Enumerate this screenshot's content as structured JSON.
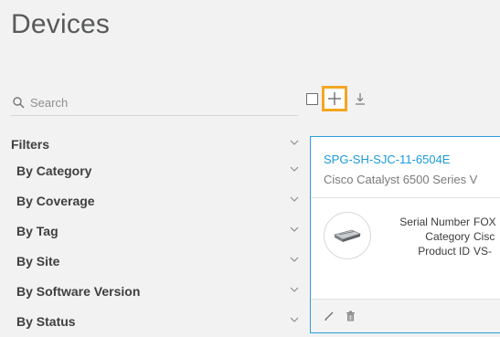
{
  "page": {
    "title": "Devices"
  },
  "search": {
    "placeholder": "Search"
  },
  "filters": {
    "header": "Filters",
    "items": [
      {
        "label": "By Category"
      },
      {
        "label": "By Coverage"
      },
      {
        "label": "By Tag"
      },
      {
        "label": "By Site"
      },
      {
        "label": "By Software Version"
      },
      {
        "label": "By Status"
      }
    ]
  },
  "device_card": {
    "name": "SPG-SH-SJC-11-6504E",
    "model": "Cisco Catalyst 6500 Series V",
    "specs": [
      {
        "key": "Serial Number",
        "value": "FOX"
      },
      {
        "key": "Category",
        "value": "Cisc"
      },
      {
        "key": "Product ID",
        "value": "VS-"
      }
    ]
  },
  "colors": {
    "accent": "#1a9bd7",
    "highlight": "#f5a623",
    "background": "#f2f2f2"
  },
  "icons": [
    "search-icon",
    "checkbox",
    "plus-icon",
    "download-icon",
    "chevron-down-icon",
    "edit-icon",
    "trash-icon"
  ]
}
